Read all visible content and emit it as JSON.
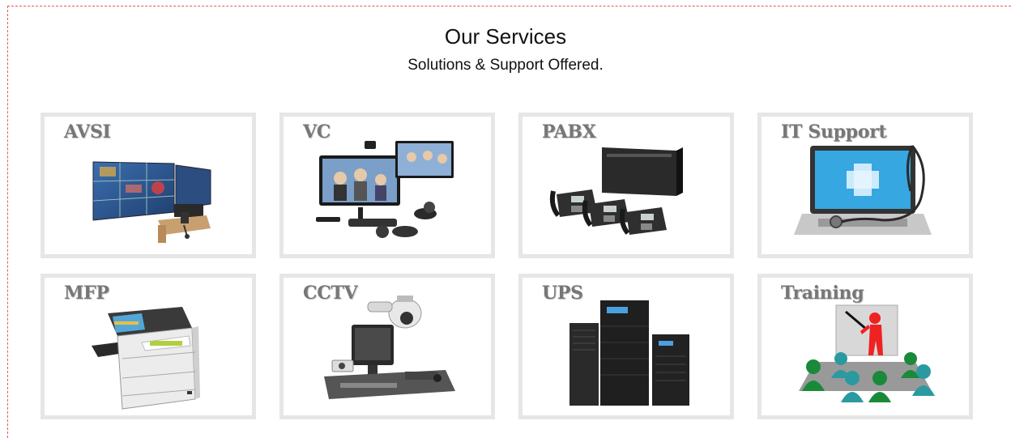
{
  "header": {
    "title": "Our Services",
    "subtitle": "Solutions & Support Offered."
  },
  "services": [
    {
      "label": "AVSI",
      "icon": "video-wall-icon"
    },
    {
      "label": "VC",
      "icon": "video-conference-icon"
    },
    {
      "label": "PABX",
      "icon": "phone-system-icon"
    },
    {
      "label": "IT Support",
      "icon": "laptop-medical-icon"
    },
    {
      "label": "MFP",
      "icon": "printer-icon"
    },
    {
      "label": "CCTV",
      "icon": "security-camera-icon"
    },
    {
      "label": "UPS",
      "icon": "ups-unit-icon"
    },
    {
      "label": "Training",
      "icon": "training-class-icon"
    }
  ]
}
